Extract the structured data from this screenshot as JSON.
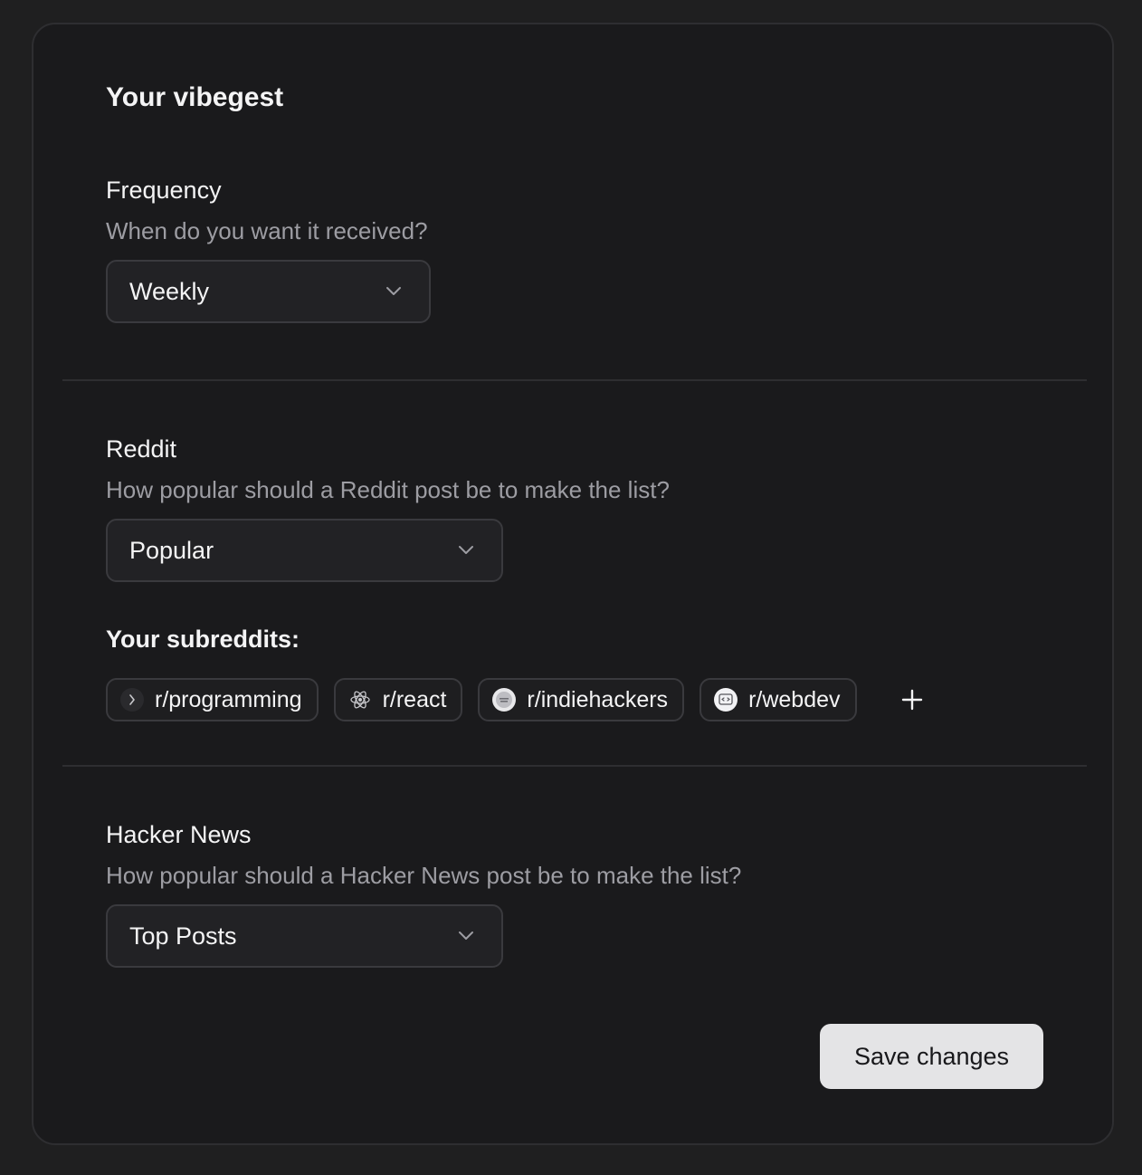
{
  "card": {
    "title": "Your vibegest"
  },
  "frequency": {
    "heading": "Frequency",
    "description": "When do you want it received?",
    "selected": "Weekly"
  },
  "reddit": {
    "heading": "Reddit",
    "description": "How popular should a Reddit post be to make the list?",
    "selected": "Popular",
    "subreddits_label": "Your subreddits:",
    "subreddits": [
      {
        "name": "r/programming",
        "icon": "programming-icon"
      },
      {
        "name": "r/react",
        "icon": "react-atom-icon"
      },
      {
        "name": "r/indiehackers",
        "icon": "indiehackers-icon"
      },
      {
        "name": "r/webdev",
        "icon": "webdev-icon"
      }
    ],
    "add_icon": "plus-icon"
  },
  "hackernews": {
    "heading": "Hacker News",
    "description": "How popular should a Hacker News post be to make the list?",
    "selected": "Top Posts"
  },
  "actions": {
    "save_label": "Save changes"
  },
  "colors": {
    "page_background": "#1f1f20",
    "card_background": "#1a1a1c",
    "border": "#2e2e31",
    "text_primary": "#f4f4f5",
    "text_secondary": "#9d9da3",
    "button_background": "#e4e4e6"
  }
}
